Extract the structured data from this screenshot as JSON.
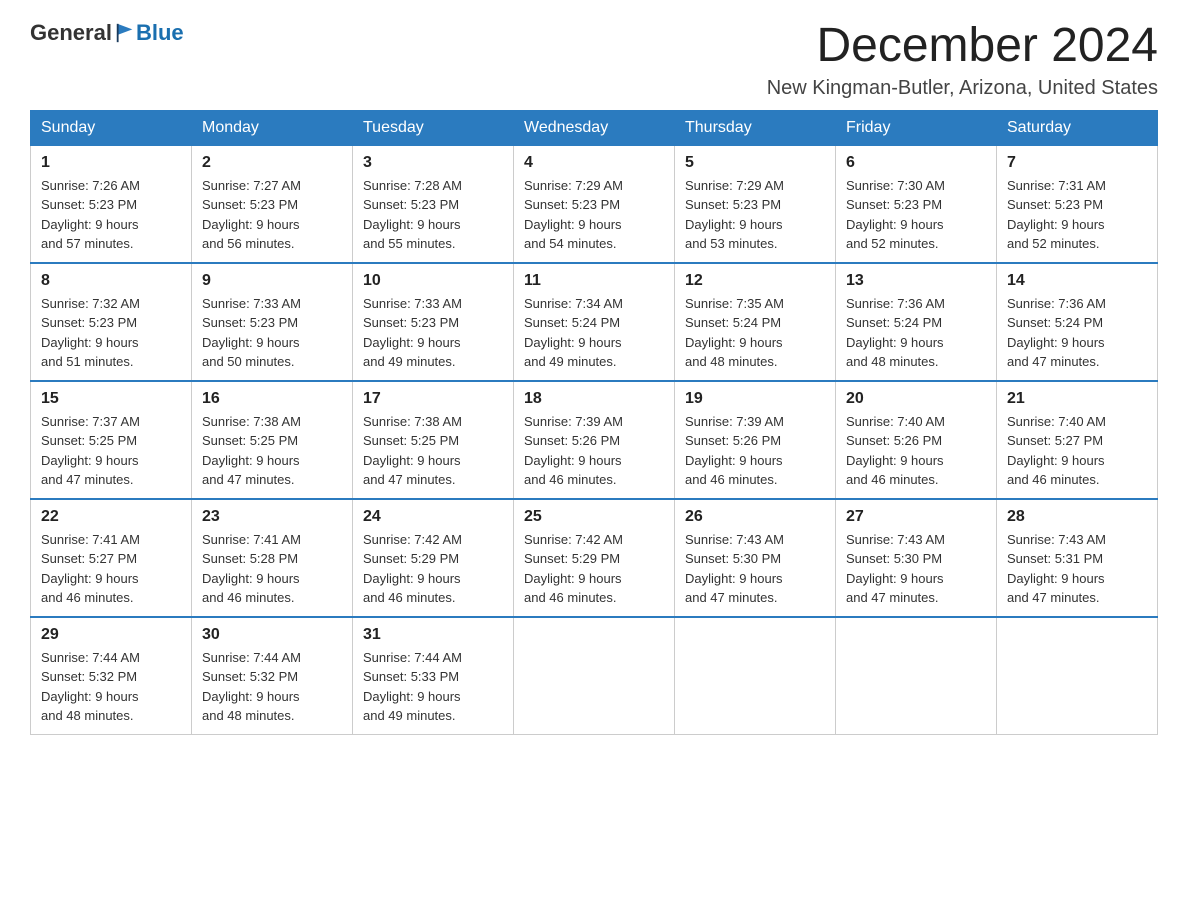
{
  "logo": {
    "general": "General",
    "blue": "Blue"
  },
  "title": "December 2024",
  "location": "New Kingman-Butler, Arizona, United States",
  "days_of_week": [
    "Sunday",
    "Monday",
    "Tuesday",
    "Wednesday",
    "Thursday",
    "Friday",
    "Saturday"
  ],
  "weeks": [
    [
      {
        "day": "1",
        "sunrise": "7:26 AM",
        "sunset": "5:23 PM",
        "daylight": "9 hours and 57 minutes."
      },
      {
        "day": "2",
        "sunrise": "7:27 AM",
        "sunset": "5:23 PM",
        "daylight": "9 hours and 56 minutes."
      },
      {
        "day": "3",
        "sunrise": "7:28 AM",
        "sunset": "5:23 PM",
        "daylight": "9 hours and 55 minutes."
      },
      {
        "day": "4",
        "sunrise": "7:29 AM",
        "sunset": "5:23 PM",
        "daylight": "9 hours and 54 minutes."
      },
      {
        "day": "5",
        "sunrise": "7:29 AM",
        "sunset": "5:23 PM",
        "daylight": "9 hours and 53 minutes."
      },
      {
        "day": "6",
        "sunrise": "7:30 AM",
        "sunset": "5:23 PM",
        "daylight": "9 hours and 52 minutes."
      },
      {
        "day": "7",
        "sunrise": "7:31 AM",
        "sunset": "5:23 PM",
        "daylight": "9 hours and 52 minutes."
      }
    ],
    [
      {
        "day": "8",
        "sunrise": "7:32 AM",
        "sunset": "5:23 PM",
        "daylight": "9 hours and 51 minutes."
      },
      {
        "day": "9",
        "sunrise": "7:33 AM",
        "sunset": "5:23 PM",
        "daylight": "9 hours and 50 minutes."
      },
      {
        "day": "10",
        "sunrise": "7:33 AM",
        "sunset": "5:23 PM",
        "daylight": "9 hours and 49 minutes."
      },
      {
        "day": "11",
        "sunrise": "7:34 AM",
        "sunset": "5:24 PM",
        "daylight": "9 hours and 49 minutes."
      },
      {
        "day": "12",
        "sunrise": "7:35 AM",
        "sunset": "5:24 PM",
        "daylight": "9 hours and 48 minutes."
      },
      {
        "day": "13",
        "sunrise": "7:36 AM",
        "sunset": "5:24 PM",
        "daylight": "9 hours and 48 minutes."
      },
      {
        "day": "14",
        "sunrise": "7:36 AM",
        "sunset": "5:24 PM",
        "daylight": "9 hours and 47 minutes."
      }
    ],
    [
      {
        "day": "15",
        "sunrise": "7:37 AM",
        "sunset": "5:25 PM",
        "daylight": "9 hours and 47 minutes."
      },
      {
        "day": "16",
        "sunrise": "7:38 AM",
        "sunset": "5:25 PM",
        "daylight": "9 hours and 47 minutes."
      },
      {
        "day": "17",
        "sunrise": "7:38 AM",
        "sunset": "5:25 PM",
        "daylight": "9 hours and 47 minutes."
      },
      {
        "day": "18",
        "sunrise": "7:39 AM",
        "sunset": "5:26 PM",
        "daylight": "9 hours and 46 minutes."
      },
      {
        "day": "19",
        "sunrise": "7:39 AM",
        "sunset": "5:26 PM",
        "daylight": "9 hours and 46 minutes."
      },
      {
        "day": "20",
        "sunrise": "7:40 AM",
        "sunset": "5:26 PM",
        "daylight": "9 hours and 46 minutes."
      },
      {
        "day": "21",
        "sunrise": "7:40 AM",
        "sunset": "5:27 PM",
        "daylight": "9 hours and 46 minutes."
      }
    ],
    [
      {
        "day": "22",
        "sunrise": "7:41 AM",
        "sunset": "5:27 PM",
        "daylight": "9 hours and 46 minutes."
      },
      {
        "day": "23",
        "sunrise": "7:41 AM",
        "sunset": "5:28 PM",
        "daylight": "9 hours and 46 minutes."
      },
      {
        "day": "24",
        "sunrise": "7:42 AM",
        "sunset": "5:29 PM",
        "daylight": "9 hours and 46 minutes."
      },
      {
        "day": "25",
        "sunrise": "7:42 AM",
        "sunset": "5:29 PM",
        "daylight": "9 hours and 46 minutes."
      },
      {
        "day": "26",
        "sunrise": "7:43 AM",
        "sunset": "5:30 PM",
        "daylight": "9 hours and 47 minutes."
      },
      {
        "day": "27",
        "sunrise": "7:43 AM",
        "sunset": "5:30 PM",
        "daylight": "9 hours and 47 minutes."
      },
      {
        "day": "28",
        "sunrise": "7:43 AM",
        "sunset": "5:31 PM",
        "daylight": "9 hours and 47 minutes."
      }
    ],
    [
      {
        "day": "29",
        "sunrise": "7:44 AM",
        "sunset": "5:32 PM",
        "daylight": "9 hours and 48 minutes."
      },
      {
        "day": "30",
        "sunrise": "7:44 AM",
        "sunset": "5:32 PM",
        "daylight": "9 hours and 48 minutes."
      },
      {
        "day": "31",
        "sunrise": "7:44 AM",
        "sunset": "5:33 PM",
        "daylight": "9 hours and 49 minutes."
      },
      null,
      null,
      null,
      null
    ]
  ],
  "labels": {
    "sunrise": "Sunrise:",
    "sunset": "Sunset:",
    "daylight": "Daylight:"
  }
}
